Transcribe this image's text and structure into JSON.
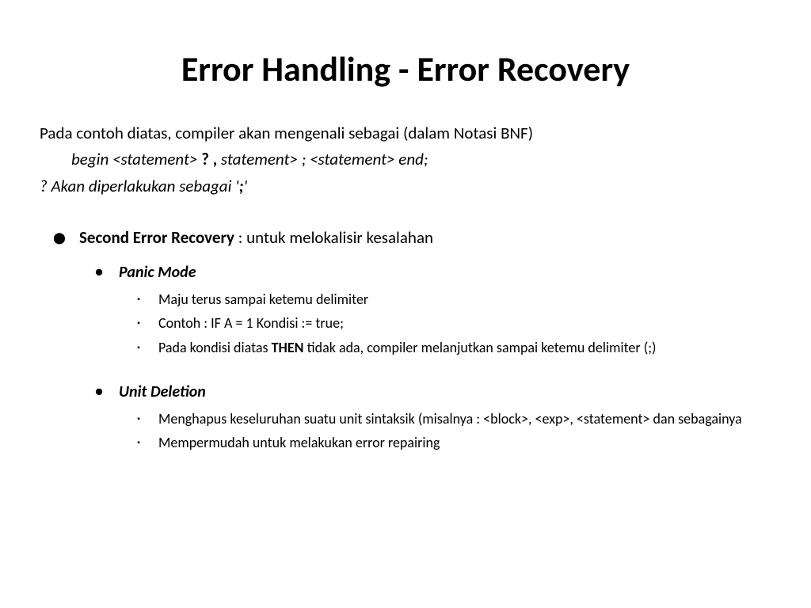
{
  "title": "Error Handling - Error Recovery",
  "intro": "Pada contoh diatas, compiler akan mengenali sebagai (dalam Notasi BNF)",
  "bnf": {
    "part1_italic": "begin  <statement>  ",
    "part2_bold": "?  ,",
    "part3_italic": "  statement>  ;  <statement> end;"
  },
  "question": {
    "part1_italic": "? Akan diperlakukan sebagai '",
    "part2_bold": ";",
    "part3_italic": "'"
  },
  "main_item": {
    "label_bold": "Second Error Recovery",
    "label_rest": " : untuk melokalisir kesalahan"
  },
  "sub1": {
    "title": "Panic Mode",
    "points": [
      {
        "text": "Maju terus sampai ketemu delimiter"
      },
      {
        "text": "Contoh : IF A = 1  Kondisi :=  true;"
      },
      {
        "prefix": "Pada kondisi diatas ",
        "bold": "THEN",
        "suffix": "  tidak ada, compiler melanjutkan sampai ketemu delimiter (;)"
      }
    ]
  },
  "sub2": {
    "title": "Unit Deletion",
    "points": [
      {
        "text": "Menghapus keseluruhan suatu unit sintaksik (misalnya : <block>, <exp>, <statement> dan sebagainya"
      },
      {
        "text": "Mempermudah untuk melakukan error repairing"
      }
    ]
  }
}
